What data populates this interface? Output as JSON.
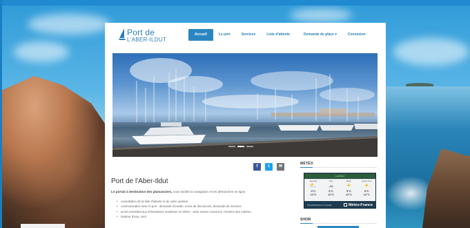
{
  "logo": {
    "title": "Port de",
    "subtitle": "L'ABER-ILDUT"
  },
  "nav": {
    "items": [
      {
        "label": "Accueil",
        "active": true
      },
      {
        "label": "Le port",
        "active": false
      },
      {
        "label": "Services",
        "active": false
      },
      {
        "label": "Liste d'attente",
        "active": false
      },
      {
        "label": "Demande de place ▾",
        "active": false
      },
      {
        "label": "Connexion",
        "active": false
      }
    ]
  },
  "slider": {
    "slides": 3,
    "current": 2
  },
  "social": {
    "facebook": "f",
    "twitter": "t",
    "email": "✉"
  },
  "content": {
    "title": "Port de l'Aber-Ildut",
    "intro_bold": "Le portail à destination des plaisanciers,",
    "intro_rest": " vous facilite la navigation et les démarches en ligne",
    "bullets": [
      "consultation de la liste d'attente et de votre position",
      "communication avec le port : demande d'escale, envoi de documents, demande de services",
      "accès immédiat aux informations maritimes et météo : carte marine navionics, horaires des marées,",
      "hauteur d'eau, vent"
    ]
  },
  "sidebar": {
    "meteo_title": "MÉTÉO",
    "widget": {
      "location": "Lanildut",
      "columns": [
        {
          "label": "Samedi",
          "icon": "cloud-sun-icon",
          "t1": "5°C",
          "t2": "12°C"
        },
        {
          "label": "Nuit",
          "icon": "cloud-icon",
          "t1": "6°C",
          "t2": "11°C"
        },
        {
          "label": "Matin",
          "icon": "sun-icon",
          "t1": "5°C",
          "t2": "12°C"
        },
        {
          "label": "Après-midi",
          "icon": "sun-icon",
          "t1": "5°C",
          "t2": "12°C"
        }
      ],
      "link": "les prévisions à 14 jours",
      "brand": "Météo-France"
    },
    "shom_title": "SHOM"
  },
  "colors": {
    "accent": "#2a86c0",
    "logo": "#2a7fb5",
    "widget_bg": "#1f3b4f"
  }
}
